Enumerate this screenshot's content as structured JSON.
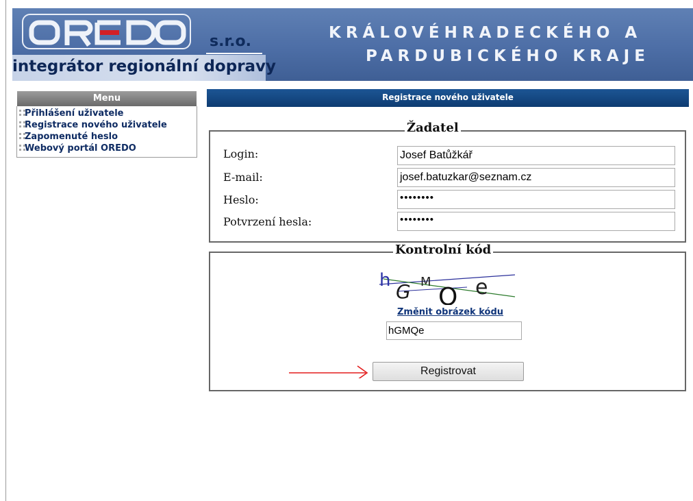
{
  "header": {
    "logo_text": "OREDO",
    "company_suffix": "s.r.o.",
    "tagline": "integrátor regionální dopravy",
    "region_line1": "KRÁLOVÉHRADECKÉHO A",
    "region_line2": "PARDUBICKÉHO KRAJE"
  },
  "menu": {
    "title": "Menu",
    "items": [
      {
        "label": "Přihlášení uživatele"
      },
      {
        "label": "Registrace nového uživatele"
      },
      {
        "label": "Zapomenuté heslo"
      },
      {
        "label": "Webový portál OREDO"
      }
    ]
  },
  "main": {
    "title": "Registrace nového uživatele",
    "applicant": {
      "legend": "Žadatel",
      "fields": [
        {
          "label": "Login:",
          "value": "Josef Batůžkář"
        },
        {
          "label": "E-mail:",
          "value": "josef.batuzkar@seznam.cz"
        },
        {
          "label": "Heslo:",
          "value": "••••••••"
        },
        {
          "label": "Potvrzení hesla:",
          "value": "••••••••"
        }
      ]
    },
    "captcha": {
      "legend": "Kontrolní kód",
      "image_text": "hGMQe",
      "change_link": "Změnit obrázek kódu",
      "code_value": "hGMQe"
    },
    "submit_label": "Registrovat"
  },
  "colors": {
    "header_blue": "#4d6ea6",
    "title_bar": "#0e3c72",
    "link": "#0f2c63",
    "arrow": "#e31c1c"
  }
}
